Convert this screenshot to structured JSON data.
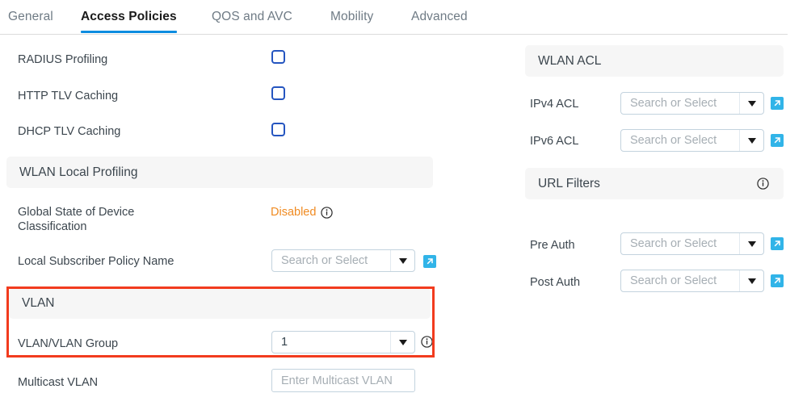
{
  "tabs": [
    {
      "label": "General",
      "active": false
    },
    {
      "label": "Access Policies",
      "active": true
    },
    {
      "label": "QOS and AVC",
      "active": false
    },
    {
      "label": "Mobility",
      "active": false
    },
    {
      "label": "Advanced",
      "active": false
    }
  ],
  "left_panel": {
    "checkbox_rows": [
      {
        "label": "RADIUS Profiling",
        "checked": false
      },
      {
        "label": "HTTP TLV Caching",
        "checked": false
      },
      {
        "label": "DHCP TLV Caching",
        "checked": false
      }
    ],
    "wlan_local_profiling": {
      "section_title": "WLAN Local Profiling",
      "global_state_label": "Global State of Device Classification",
      "global_state_value": "Disabled",
      "local_subscriber_label": "Local Subscriber Policy Name",
      "local_subscriber_placeholder": "Search or Select"
    },
    "vlan": {
      "section_title": "VLAN",
      "vlan_group_label": "VLAN/VLAN Group",
      "vlan_group_value": "1",
      "multicast_label": "Multicast VLAN",
      "multicast_placeholder": "Enter Multicast VLAN"
    }
  },
  "right_panel": {
    "wlan_acl": {
      "section_title": "WLAN ACL",
      "ipv4_label": "IPv4 ACL",
      "ipv4_placeholder": "Search or Select",
      "ipv6_label": "IPv6 ACL",
      "ipv6_placeholder": "Search or Select"
    },
    "url_filters": {
      "section_title": "URL Filters",
      "pre_auth_label": "Pre Auth",
      "pre_auth_placeholder": "Search or Select",
      "post_auth_label": "Post Auth",
      "post_auth_placeholder": "Search or Select"
    }
  },
  "icons": {
    "info": "info-circle-icon",
    "external_link": "external-link-icon",
    "dropdown": "chevron-down-icon"
  },
  "colors": {
    "active_tab_underline": "#0d8ce0",
    "checkbox_border": "#2555c0",
    "status_warning": "#f08b22",
    "external_link_bg": "#31b4e8",
    "annotation_highlight": "#f23b1e",
    "section_band_bg": "#f6f6f6"
  }
}
